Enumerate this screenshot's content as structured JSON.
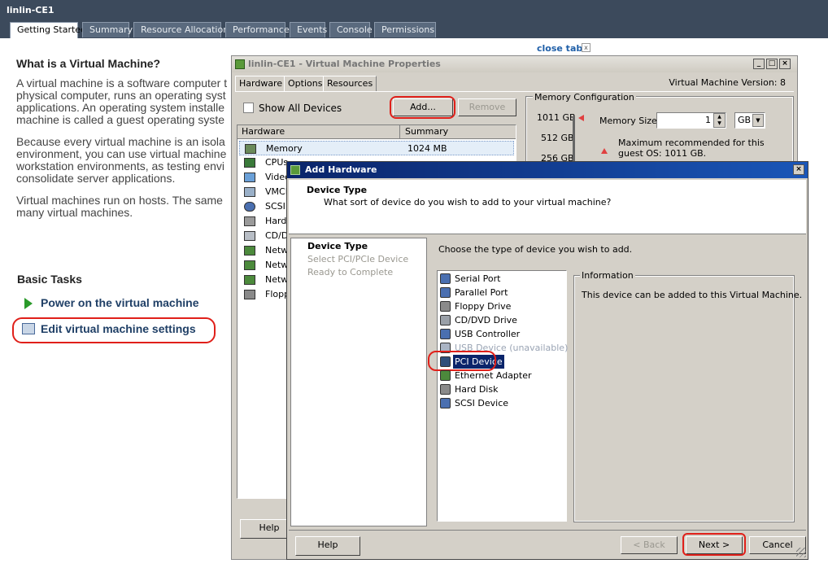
{
  "window": {
    "vm_name": "linlin-CE1"
  },
  "tabs": [
    "Getting Started",
    "Summary",
    "Resource Allocation",
    "Performance",
    "Events",
    "Console",
    "Permissions"
  ],
  "close_tab": {
    "label": "close tab"
  },
  "getting_started": {
    "heading": "What is a Virtual Machine?",
    "para1": [
      "A virtual machine is a software computer t",
      "physical computer, runs an operating syst",
      "applications. An operating system installe",
      "machine is called a guest operating syste"
    ],
    "para2": [
      "Because every virtual machine is an isola",
      "environment, you can use virtual machine",
      "workstation environments, as testing envi",
      "consolidate server applications."
    ],
    "para3": [
      "Virtual machines run on hosts. The same",
      "many virtual machines."
    ],
    "basic_tasks": "Basic Tasks",
    "task_power": "Power on the virtual machine",
    "task_edit": "Edit virtual machine settings"
  },
  "props": {
    "title": "linlin-CE1 - Virtual Machine Properties",
    "tabs": [
      "Hardware",
      "Options",
      "Resources"
    ],
    "version": "Virtual Machine Version: 8",
    "show_all": "Show All Devices",
    "add_button": "Add...",
    "remove_button": "Remove",
    "columns": [
      "Hardware",
      "Summary"
    ],
    "rows": [
      {
        "name": "Memory",
        "summary": "1024 MB",
        "icon": "memory-icon"
      },
      {
        "name": "CPUs",
        "summary": "",
        "icon": "cpu-icon"
      },
      {
        "name": "Video",
        "summary": "",
        "icon": "video-icon"
      },
      {
        "name": "VMCI",
        "summary": "",
        "icon": "vmci-icon"
      },
      {
        "name": "SCSI",
        "summary": "",
        "icon": "scsi-icon"
      },
      {
        "name": "Hard",
        "summary": "",
        "icon": "disk-icon"
      },
      {
        "name": "CD/D",
        "summary": "",
        "icon": "cd-icon"
      },
      {
        "name": "Netw",
        "summary": "",
        "icon": "network-icon"
      },
      {
        "name": "Netw",
        "summary": "",
        "icon": "network-icon"
      },
      {
        "name": "Netw",
        "summary": "",
        "icon": "network-icon"
      },
      {
        "name": "Flopp",
        "summary": "",
        "icon": "floppy-icon"
      }
    ],
    "mem_config_title": "Memory Configuration",
    "mem_scale": [
      "1011 GB",
      "512 GB",
      "256 GB"
    ],
    "mem_size_label": "Memory Size:",
    "mem_size_value": "1",
    "mem_unit": "GB",
    "mem_note": [
      "Maximum recommended for this",
      "guest OS: 1011 GB."
    ],
    "help_button": "Help"
  },
  "add_hardware": {
    "title": "Add Hardware",
    "header_title": "Device Type",
    "header_sub": "What sort of device do you wish to add to your virtual machine?",
    "steps": [
      "Device Type",
      "Select PCI/PCIe Device",
      "Ready to Complete"
    ],
    "instruction": "Choose the type of device you wish to add.",
    "devices": [
      {
        "label": "Serial Port",
        "icon": "serial-port-icon",
        "color": "#4a6fb0",
        "disabled": false,
        "selected": false
      },
      {
        "label": "Parallel Port",
        "icon": "parallel-port-icon",
        "color": "#4a6fb0",
        "disabled": false,
        "selected": false
      },
      {
        "label": "Floppy Drive",
        "icon": "floppy-icon",
        "color": "#8a8a8a",
        "disabled": false,
        "selected": false
      },
      {
        "label": "CD/DVD Drive",
        "icon": "cd-icon",
        "color": "#9aa0a8",
        "disabled": false,
        "selected": false
      },
      {
        "label": "USB Controller",
        "icon": "usb-controller-icon",
        "color": "#4a6fb0",
        "disabled": false,
        "selected": false
      },
      {
        "label": "USB Device (unavailable)",
        "icon": "usb-device-icon",
        "color": "#aab4c4",
        "disabled": true,
        "selected": false
      },
      {
        "label": "PCI Device",
        "icon": "pci-icon",
        "color": "#2e4f7a",
        "disabled": false,
        "selected": true
      },
      {
        "label": "Ethernet Adapter",
        "icon": "ethernet-icon",
        "color": "#4c8a3c",
        "disabled": false,
        "selected": false
      },
      {
        "label": "Hard Disk",
        "icon": "hard-disk-icon",
        "color": "#8a8a8a",
        "disabled": false,
        "selected": false
      },
      {
        "label": "SCSI Device",
        "icon": "scsi-icon",
        "color": "#4a6fb0",
        "disabled": false,
        "selected": false
      }
    ],
    "info_title": "Information",
    "info_text": "This device can be added to this Virtual Machine.",
    "help_button": "Help",
    "back_button": "< Back",
    "next_button": "Next >",
    "cancel_button": "Cancel"
  }
}
